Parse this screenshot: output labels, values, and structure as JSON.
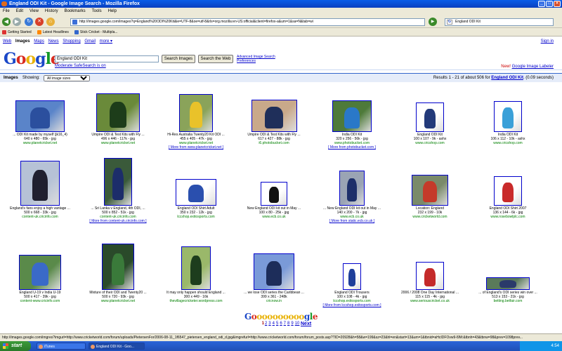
{
  "window": {
    "title": "England ODI Kit - Google Image Search - Mozilla Firefox"
  },
  "menu": [
    "File",
    "Edit",
    "View",
    "History",
    "Bookmarks",
    "Tools",
    "Help"
  ],
  "nav": {
    "url": "http://images.google.com/images?q=England%20ODI%20Kit&ie=UTF-8&oe=utf-8&rls=org.mozilla:en-US:official&client=firefox-a&um=1&sa=N&tab=wi",
    "search_value": "England ODI Kit"
  },
  "bookmarks": [
    {
      "label": "Getting Started",
      "color": "#d33"
    },
    {
      "label": "Latest Headlines",
      "color": "#f80"
    },
    {
      "label": "Stick Cricket - Multipla...",
      "color": "#36c"
    }
  ],
  "google_bar": {
    "links": [
      "Web",
      "Images",
      "Maps",
      "News",
      "Shopping",
      "Gmail",
      "more ▾"
    ],
    "active": "Images",
    "sign_in": "Sign in"
  },
  "header": {
    "logo": [
      "G",
      "o",
      "o",
      "g",
      "l",
      "e"
    ],
    "query": "England ODI Kit",
    "search_images_btn": "Search Images",
    "search_web_btn": "Search the Web",
    "advanced": "Advanced Image Search",
    "preferences": "Preferences",
    "safesearch": "Moderate SafeSearch is on",
    "labeler_new": "New!",
    "labeler_link": "Google Image Labeler"
  },
  "results_bar": {
    "label": "Images",
    "showing": "Showing:",
    "size_option": "All image sizes",
    "stats_prefix": "Results 1 - 21 of about 506 for",
    "stats_query": "England ODI Kit",
    "stats_time": ". (0.09 seconds)"
  },
  "results": [
    {
      "title": "... ODI Kit made by myself (jk16_4)",
      "meta": "640 x 480 - 65k - jpg",
      "site": "www.planetcricket.net",
      "more": "",
      "c1": "#5a84c9",
      "c2": "#2b4f9e"
    },
    {
      "title": "Umpire ODI & Test Kits with Fly ...",
      "meta": "496 x 446 - 117k - jpg",
      "site": "www.planetcricket.net",
      "more": "",
      "c1": "#6a8a3a",
      "c2": "#1d3d1a"
    },
    {
      "title": "Hi-Res Australia Twenty20 Kit ODI ...",
      "meta": "455 x 405 - 47k - jpg",
      "site": "www.planetcricket.net",
      "more": "[ More from www.planetcricket.net ]",
      "c1": "#8aa35a",
      "c2": "#e9c22a"
    },
    {
      "title": "Umpire ODI & Test Kits with Fly ...",
      "meta": "617 x 427 - 88k - jpg",
      "site": "i6.photobucket.com",
      "more": "",
      "c1": "#c9a98a",
      "c2": "#1f2f5a"
    },
    {
      "title": "India ODI Kit",
      "meta": "320 x 256 - 56k - jpg",
      "site": "www.photobucket.com",
      "more": "[ More from photobucket.com ]",
      "c1": "#4e7a3a",
      "c2": "#2a78c8"
    },
    {
      "title": "England ODI Kit",
      "meta": "100 x 107 - 9k - ashx",
      "site": "www.cricshop.com",
      "more": "",
      "c1": "#ffffff",
      "c2": "#233a7a"
    },
    {
      "title": "India ODI Kit",
      "meta": "106 x 112 - 10k - ashx",
      "site": "www.cricshop.com",
      "more": "",
      "c1": "#ffffff",
      "c2": "#3aa0d8"
    },
    {
      "title": "England's fans enjoy a high vantage ...",
      "meta": "500 x 668 - 33k - jpg",
      "site": "content-uk.cricinfo.com",
      "more": "",
      "c1": "#b6c2d6",
      "c2": "#202030"
    },
    {
      "title": "... Sri Lanka v England, 4th ODI, ...",
      "meta": "500 x 852 - 51k - jpg",
      "site": "content-uk.cricinfo.com",
      "more": "[ More from content-uk.cricinfo.com ]",
      "c1": "#3a5a3a",
      "c2": "#1c2d6a"
    },
    {
      "title": "England ODI Shirt Adult",
      "meta": "350 x 232 - 12k - jpg",
      "site": "lccshop.exitosports.com",
      "more": "",
      "c1": "#ffffff",
      "c2": "#2a4fae"
    },
    {
      "title": "New England ODI kit out in May ...",
      "meta": "100 x 80 - 25k - jpg",
      "site": "www.ecb.co.uk",
      "more": "",
      "c1": "#ffffff",
      "c2": "#111111"
    },
    {
      "title": "... New England ODI kit out in May ...",
      "meta": "140 x 200 - 7k - jpg",
      "site": "www.ecb.co.uk",
      "more": "[ More from static.ecb.co.uk ]",
      "c1": "#9aa4b4",
      "c2": "#1d2f6a"
    },
    {
      "title": "Location: England",
      "meta": "232 x 199 - 10k",
      "site": "www.cricketworld.com",
      "more": "",
      "c1": "#7a8a6a",
      "c2": "#c43a2a"
    },
    {
      "title": "England ODI Shirt 2007",
      "meta": "136 x 144 - 6k - jpg",
      "site": "www.rosebowlplc.com",
      "more": "",
      "c1": "#ffffff",
      "c2": "#c92a2a"
    },
    {
      "title": "England U-19 v India U-19",
      "meta": "500 x 417 - 39k - jpg",
      "site": "content-www.cricinfo.com",
      "more": "",
      "c1": "#5a8a4a",
      "c2": "#3a6ac8"
    },
    {
      "title": "Mixture of their ODI and Twenty20 ...",
      "meta": "500 x 720 - 93k - jpg",
      "site": "www.planetcricket.net",
      "more": "",
      "c1": "#2a4a2a",
      "c2": "#3a7a3a"
    },
    {
      "title": "It may only happen should England ...",
      "meta": "300 x 449 - 16k",
      "site": "thevillagecricketer.wordpress.com",
      "more": "",
      "c1": "#9ab86a",
      "c2": "#1d3d1d"
    },
    {
      "title": "... we lose ODI series the Caribbean ...",
      "meta": "399 x 361 - 248k",
      "site": "cricnow.in",
      "more": "",
      "c1": "#7a9ad8",
      "c2": "#1d2d5a"
    },
    {
      "title": "England ODI Trousers",
      "meta": "100 x 108 - 4k - jpg",
      "site": "lccshop.exitosports.com",
      "more": "[ More from lccshop.exitosports.com ]",
      "c1": "#ffffff",
      "c2": "#1f3f9a"
    },
    {
      "title": "2006 / 2008 One Day International ...",
      "meta": "115 x 115 - 4k - jpg",
      "site": "www.seriouscricket.co.uk",
      "more": "",
      "c1": "#ffffff",
      "c2": "#c42a2a"
    },
    {
      "title": "... of England's ODI series win over ...",
      "meta": "513 x 153 - 21k - jpg",
      "site": "betting.betfair.com",
      "more": "",
      "c1": "#5a7a5a",
      "c2": "#2a3a6a"
    }
  ],
  "pager": {
    "goo": [
      "G",
      "o",
      "o",
      "o",
      "o",
      "o",
      "o",
      "o",
      "o",
      "o",
      "o",
      "g",
      "l",
      "e"
    ],
    "pages": [
      "1",
      "2",
      "3",
      "4",
      "5",
      "6",
      "7",
      "8",
      "9",
      "10"
    ],
    "current": "1",
    "next": "Next"
  },
  "status": "http://images.google.com/imgres?imgurl=http://www.cricketworld.com/forum/uploads/PietersenFor/2006-08-11_1f6547_pietersen_england_odi_d.jpg&imgrefurl=http://www.cricketworld.com/forum/forum_posts.asp?TID=20928&h=58&w=199&sz=23&hl=en&start=13&um=1&tbnid=aHcIDFOvw9-l9M:&tbnh=43&tbnw=98&prev=1098prev...",
  "taskbar": {
    "start": "start",
    "tasks": [
      "iTunes",
      "England ODI Kit - Goo..."
    ],
    "clock": "4:54"
  }
}
